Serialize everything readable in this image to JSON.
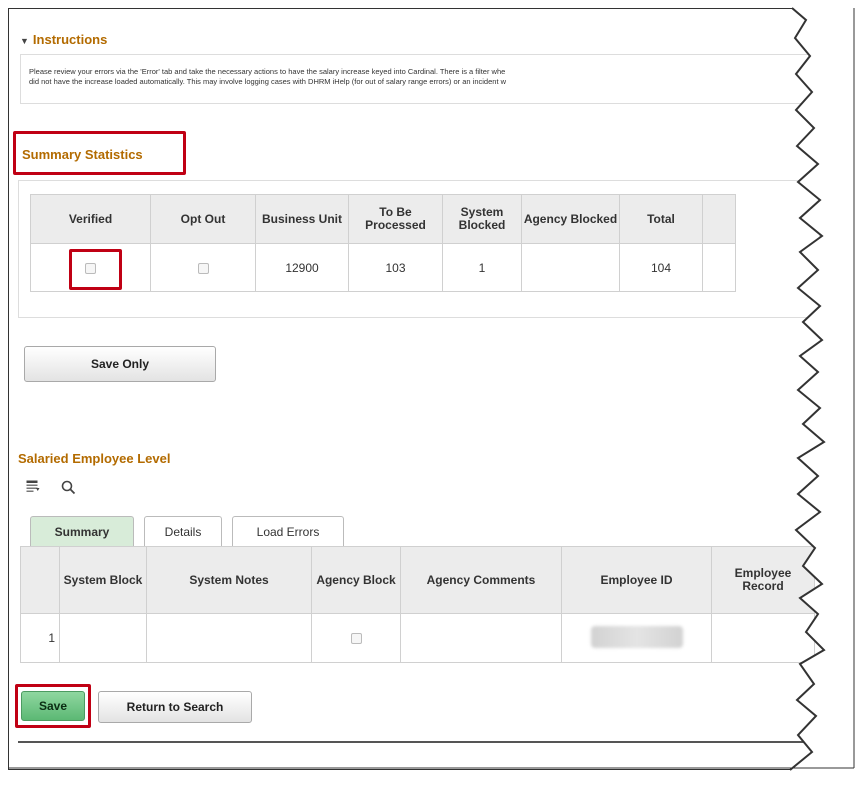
{
  "instructions": {
    "title": "Instructions",
    "line1": "Please review your errors via the 'Error' tab and take the necessary actions to have the salary increase keyed into Cardinal. There is a filter whe",
    "line2": "did not have the increase loaded automatically. This may involve logging cases with DHRM iHelp (for out of salary range errors) or an incident w"
  },
  "summary_stats": {
    "title": "Summary Statistics",
    "headers": [
      "Verified",
      "Opt Out",
      "Business Unit",
      "To Be Processed",
      "System Blocked",
      "Agency Blocked",
      "Total"
    ],
    "row": {
      "verified": false,
      "opt_out": false,
      "business_unit": "12900",
      "to_be_processed": "103",
      "system_blocked": "1",
      "agency_blocked": "",
      "total": "104"
    }
  },
  "save_only_label": "Save Only",
  "employee_level": {
    "title": "Salaried Employee Level",
    "tabs": [
      "Summary",
      "Details",
      "Load Errors"
    ],
    "active_tab": "Summary",
    "headers": [
      "",
      "System Block",
      "System Notes",
      "Agency Block",
      "Agency Comments",
      "Employee ID",
      "Employee Record"
    ],
    "row": {
      "num": "1",
      "system_block": "",
      "system_notes": "",
      "agency_block": false,
      "agency_comments": "",
      "employee_id": "",
      "employee_record": ""
    }
  },
  "footer": {
    "save_label": "Save",
    "return_label": "Return to Search"
  },
  "colors": {
    "section_title": "#b36b00",
    "highlight": "#c00014",
    "save_button": "#5cb874",
    "active_tab": "#d8ecd9"
  },
  "icons": [
    "caret-down-icon",
    "grid-personalize-icon",
    "search-icon",
    "checkbox-icon"
  ]
}
